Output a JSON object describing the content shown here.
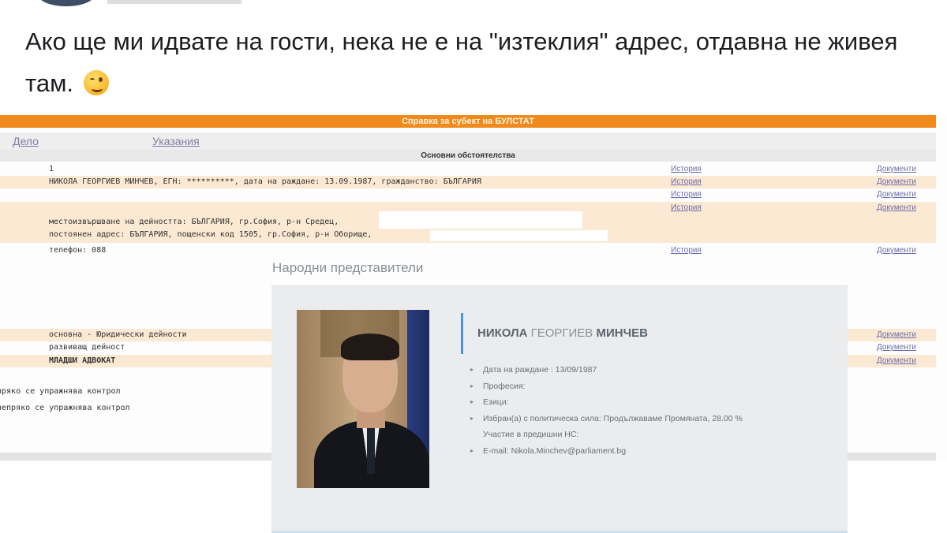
{
  "post": {
    "text": "Ако ще ми идвате на гости, нека не е на \"изтеклия\" адрес, отдавна не живея там.",
    "emoji": "winking-face"
  },
  "registry": {
    "header_title": "Справка за субект на БУЛСТАТ",
    "tabs": [
      "Дело",
      "Указания"
    ],
    "section_title": "Основни обстоятелства",
    "rows": [
      {
        "text": "1",
        "link_a": "История",
        "link_b": "Документи"
      },
      {
        "text": "НИКОЛА ГЕОРГИЕВ МИНЧЕВ, ЕГН: **********,  дата на раждане: 13.09.1987, гражданство: БЪЛГАРИЯ",
        "link_a": "История",
        "link_b": "Документи"
      },
      {
        "text": "",
        "link_a": "История",
        "link_b": "Документи"
      },
      {
        "text": "",
        "link_a": "История",
        "link_b": "Документи"
      },
      {
        "text": "местоизвършване на дейността: БЪЛГАРИЯ, гр.София, р-н Средец,"
      },
      {
        "text": "постоянен адрес: БЪЛГАРИЯ, пощенски код 1505, гр.София, р-н Оборище,"
      },
      {
        "text": "телефон: 088",
        "link_a": "История",
        "link_b": "Документи"
      },
      {
        "text": "основна - Юридически дейности",
        "link_b": "Документи"
      },
      {
        "text": "развиващ дейност",
        "link_b": "Документи"
      },
      {
        "text": "МЛАДШИ АДВОКАТ",
        "link_b": "Документи"
      },
      {
        "text": "пряко се упражнява контрол"
      },
      {
        "text": "непряко се упражнява контрол"
      }
    ]
  },
  "parliament": {
    "section_title": "Народни представители",
    "name_first": "НИКОЛА",
    "name_middle": "ГЕОРГИЕВ",
    "name_last": "МИНЧЕВ",
    "details": [
      "Дата на раждане : 13/09/1987",
      "Професия:",
      "Езици:",
      "Избран(а) с политическа сила: Продължаваме Промяната, 28.00 %",
      "Участие в предишни НС:",
      "E-mail: Nikola.Minchev@parliament.bg"
    ]
  },
  "colors": {
    "registry_header": "#f08a1c",
    "registry_band": "#fbe9d3",
    "link": "#6c6cab",
    "card_bg": "#eaeced",
    "name_accent": "#4a94d8"
  }
}
